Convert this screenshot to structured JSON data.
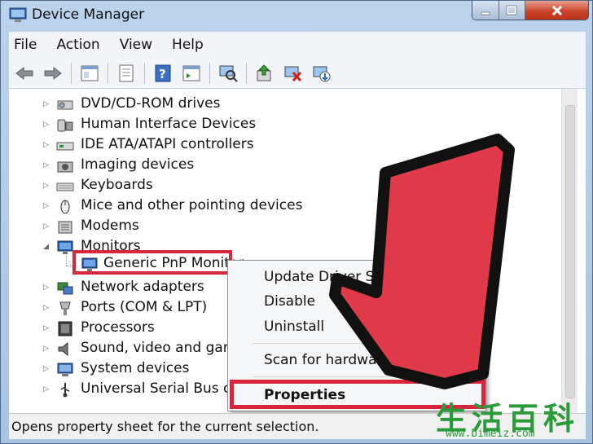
{
  "window": {
    "title": "Device Manager"
  },
  "menu": [
    "File",
    "Action",
    "View",
    "Help"
  ],
  "toolbar_icons": [
    "back-arrow-icon",
    "forward-arrow-icon",
    "show-hide-tree-icon",
    "properties-icon",
    "help-icon",
    "action-pane-icon",
    "scan-hardware-icon",
    "update-driver-icon",
    "disable-device-icon",
    "uninstall-device-icon"
  ],
  "tree": [
    {
      "label": "DVD/CD-ROM drives",
      "icon": "dvd-drive-icon",
      "expanded": false
    },
    {
      "label": "Human Interface Devices",
      "icon": "hid-icon",
      "expanded": false
    },
    {
      "label": "IDE ATA/ATAPI controllers",
      "icon": "ide-controller-icon",
      "expanded": false
    },
    {
      "label": "Imaging devices",
      "icon": "camera-icon",
      "expanded": false
    },
    {
      "label": "Keyboards",
      "icon": "keyboard-icon",
      "expanded": false
    },
    {
      "label": "Mice and other pointing devices",
      "icon": "mouse-icon",
      "expanded": false
    },
    {
      "label": "Modems",
      "icon": "modem-icon",
      "expanded": false
    },
    {
      "label": "Monitors",
      "icon": "monitor-icon",
      "expanded": true
    },
    {
      "label": "Network adapters",
      "icon": "network-icon",
      "expanded": false
    },
    {
      "label": "Ports (COM & LPT)",
      "icon": "port-icon",
      "expanded": false
    },
    {
      "label": "Processors",
      "icon": "processor-icon",
      "expanded": false
    },
    {
      "label": "Sound, video and game",
      "icon": "speaker-icon",
      "expanded": false
    },
    {
      "label": "System devices",
      "icon": "system-icon",
      "expanded": false
    },
    {
      "label": "Universal Serial Bus cont",
      "icon": "usb-icon",
      "expanded": false
    }
  ],
  "selected_child": {
    "label": "Generic PnP Monitor",
    "icon": "monitor-icon"
  },
  "context_menu": {
    "update": "Update Driver Software...",
    "disable": "Disable",
    "uninstall": "Uninstall",
    "scan": "Scan for hardware changes",
    "properties": "Properties"
  },
  "status": "Opens property sheet for the current selection.",
  "watermark": {
    "glyphs": "生活百科",
    "url": "www.bimeiz.com"
  },
  "colors": {
    "highlight": "#d8263d",
    "arrow_fill": "#e03a4a"
  }
}
